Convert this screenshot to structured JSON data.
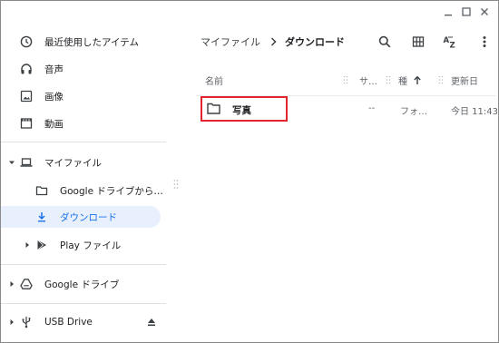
{
  "window": {
    "controls": {
      "minimize_icon": "minimize-icon",
      "maximize_icon": "maximize-icon",
      "close_icon": "close-icon"
    }
  },
  "sidebar": {
    "recent": {
      "label": "最近使用したアイテム",
      "icon": "clock-icon"
    },
    "audio": {
      "label": "音声",
      "icon": "headphones-icon"
    },
    "images": {
      "label": "画像",
      "icon": "image-icon"
    },
    "videos": {
      "label": "動画",
      "icon": "film-icon"
    },
    "my_files": {
      "label": "マイファイル",
      "icon": "laptop-icon"
    },
    "google_drive_folder": {
      "label": "Google ドライブから…",
      "icon": "folder-icon"
    },
    "downloads": {
      "label": "ダウンロード",
      "icon": "download-icon"
    },
    "play_files": {
      "label": "Play ファイル",
      "icon": "play-icon"
    },
    "google_drive": {
      "label": "Google ドライブ",
      "icon": "drive-icon"
    },
    "usb": {
      "label": "USB Drive",
      "icon": "usb-icon",
      "eject_icon": "eject-icon"
    }
  },
  "header": {
    "breadcrumb": [
      "マイファイル",
      "ダウンロード"
    ],
    "tools": [
      "search-icon",
      "grid-view-icon",
      "sort-az-icon",
      "more-vert-icon"
    ]
  },
  "table": {
    "columns": {
      "name": "名前",
      "size": "サ…",
      "type": "種",
      "modified": "更新日"
    },
    "rows": [
      {
        "name": "写真",
        "size": "--",
        "type": "フォ…",
        "modified": "今日 11:43",
        "icon": "folder-icon"
      }
    ]
  },
  "colors": {
    "accent": "#1a73e8",
    "selected_bg": "#e8f0fe",
    "highlight_box": "#e2242f"
  }
}
